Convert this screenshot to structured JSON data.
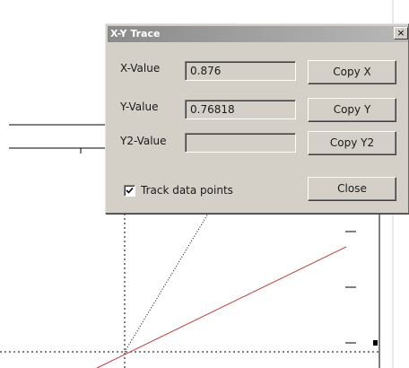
{
  "dialog": {
    "title": "X-Y Trace",
    "close_glyph": "×",
    "fields": [
      {
        "label": "X-Value",
        "value": "0.876"
      },
      {
        "label": "Y-Value",
        "value": "0.76818"
      },
      {
        "label": "Y2-Value",
        "value": ""
      }
    ],
    "buttons": {
      "copy_x": "Copy X",
      "copy_y": "Copy Y",
      "copy_y2": "Copy Y2",
      "close": "Close"
    },
    "track_checkbox": {
      "label": "Track data points",
      "checked": true
    }
  },
  "colors": {
    "dialog_face": "#d4d0c8",
    "trace_line": "#c04040",
    "axis_line": "#000000"
  },
  "icons": {
    "close": "close-icon",
    "check": "checkmark-icon"
  }
}
